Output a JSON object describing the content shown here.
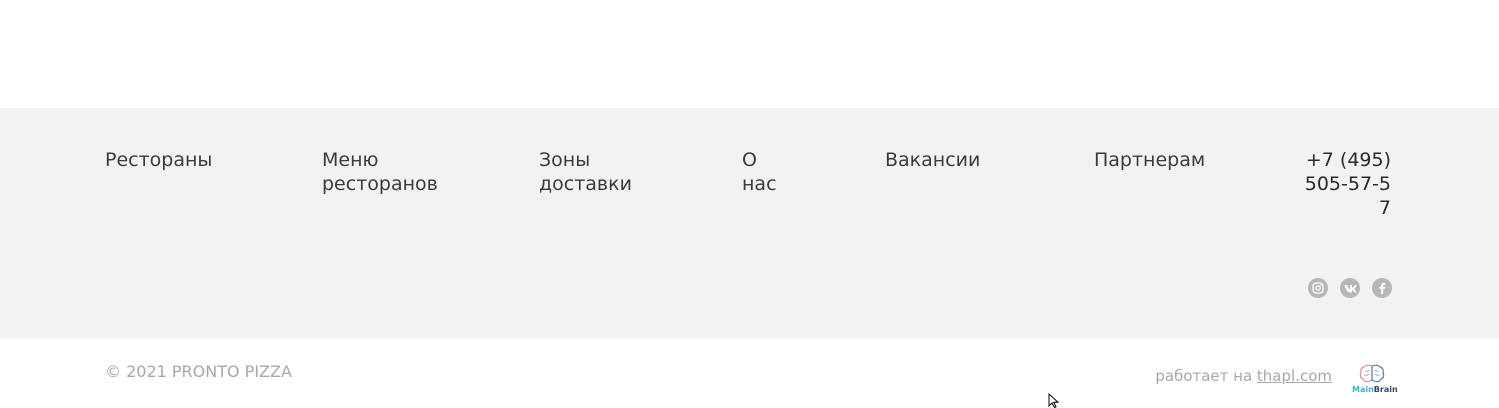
{
  "footer": {
    "nav": [
      {
        "label": "Рестораны"
      },
      {
        "label": "Меню ресторанов"
      },
      {
        "label": "Зоны доставки"
      },
      {
        "label": "О нас"
      },
      {
        "label": "Вакансии"
      },
      {
        "label": "Партнерам"
      }
    ],
    "phone": "+7 (495) 505-57-57",
    "socials": [
      "instagram-icon",
      "vk-icon",
      "facebook-icon"
    ],
    "colors": {
      "background": "#f4f1f4",
      "nav_text": "#3b3b3b",
      "muted_text": "#a9a6a9",
      "social_icon": "#b9b6b9"
    }
  },
  "bottom": {
    "copyright": "© 2021 PRONTO PIZZA",
    "powered_prefix": "работает на",
    "powered_link": "thapl.com",
    "brand_main": "Main",
    "brand_rest": "Brain"
  }
}
